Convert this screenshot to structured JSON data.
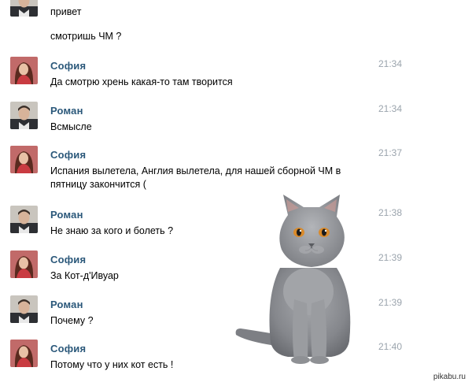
{
  "chat": {
    "messages": [
      {
        "sender": "",
        "avatar": "roman-avatar",
        "time": "",
        "lines": [
          "привет"
        ]
      },
      {
        "sender": "",
        "avatar": "",
        "time": "",
        "lines": [
          "смотришь ЧМ ?"
        ]
      },
      {
        "sender": "София",
        "avatar": "sofia-avatar",
        "time": "21:34",
        "lines": [
          "Да смотрю хрень какая-то там творится"
        ]
      },
      {
        "sender": "Роман",
        "avatar": "roman-avatar",
        "time": "21:34",
        "lines": [
          "Всмысле"
        ]
      },
      {
        "sender": "София",
        "avatar": "sofia-avatar",
        "time": "21:37",
        "lines": [
          "Испания вылетела, Англия вылетела, для нашей сборной ЧМ в",
          "пятницу закончится ("
        ]
      },
      {
        "sender": "Роман",
        "avatar": "roman-avatar",
        "time": "21:38",
        "lines": [
          "Не знаю за кого и болеть ?"
        ]
      },
      {
        "sender": "София",
        "avatar": "sofia-avatar",
        "time": "21:39",
        "lines": [
          "За Кот-д'Ивуар"
        ]
      },
      {
        "sender": "Роман",
        "avatar": "roman-avatar",
        "time": "21:39",
        "lines": [
          "Почему ?"
        ]
      },
      {
        "sender": "София",
        "avatar": "sofia-avatar",
        "time": "21:40",
        "lines": [
          "Потому что у них кот есть !"
        ]
      }
    ]
  },
  "colors": {
    "name": "#2b587a",
    "time": "#9ba4ad",
    "text": "#000000"
  },
  "watermark": "pikabu.ru"
}
